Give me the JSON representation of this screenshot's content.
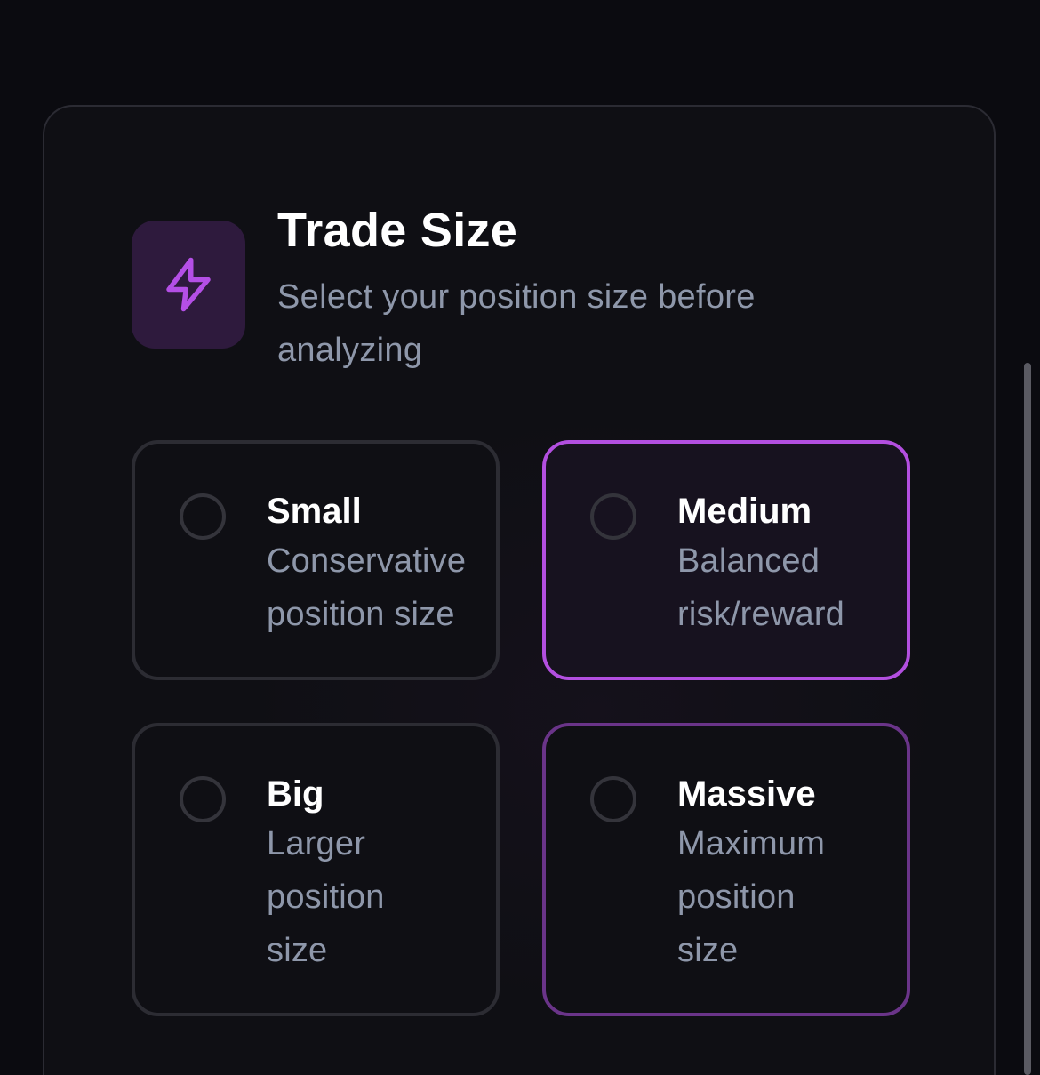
{
  "header": {
    "icon": "lightning-bolt-icon",
    "title": "Trade Size",
    "subtitle": "Select your position size before analyzing"
  },
  "options": [
    {
      "label": "Small",
      "description": "Conservative position size",
      "selected": false
    },
    {
      "label": "Medium",
      "description": "Balanced risk/reward",
      "selected": true
    },
    {
      "label": "Big",
      "description": "Larger position size",
      "selected": false
    },
    {
      "label": "Massive",
      "description": "Maximum position size",
      "selected": false
    }
  ],
  "colors": {
    "accent": "#b34fe0",
    "icon_bg": "#2e1a3d",
    "background": "#0b0b10",
    "muted_text": "#8e97aa"
  }
}
